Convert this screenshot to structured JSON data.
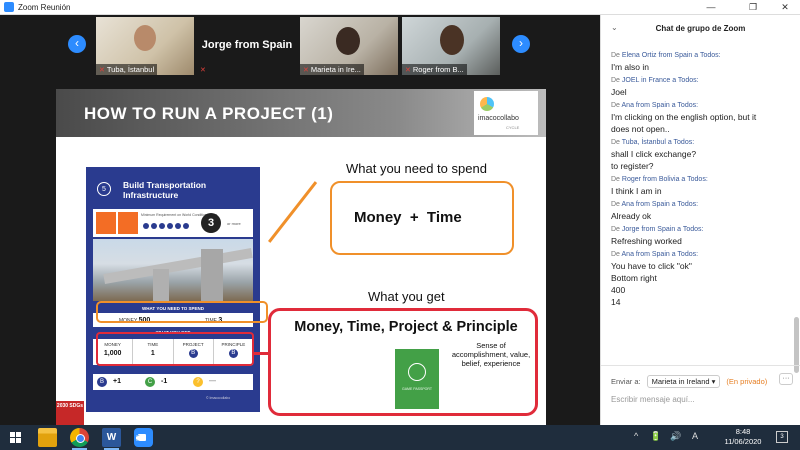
{
  "window": {
    "title": "Zoom Reunión",
    "controls": [
      "—",
      "❐",
      "✕"
    ]
  },
  "gallery": {
    "prev_icon": "chevron-left-icon",
    "next_icon": "chevron-right-icon",
    "participants": [
      {
        "name": "Tuba, İstanbul",
        "muted": true
      },
      {
        "name": "Jorge from Spain",
        "muted": true
      },
      {
        "name": "Marieta in Ire...",
        "muted": true
      },
      {
        "name": "Roger from B...",
        "muted": true
      }
    ]
  },
  "slide": {
    "title": "HOW TO RUN A PROJECT (1)",
    "logo": {
      "name": "imacocollabo",
      "tagline": "CYCLE"
    },
    "card": {
      "number": "5",
      "title_line1": "Build Transportation",
      "title_line2": "Infrastructure",
      "requirement_label": "Minimum Requirement on World Condition Meter",
      "big_number": "3",
      "unit": "or more",
      "spend_header": "WHAT YOU NEED TO SPEND",
      "money_label": "MONEY",
      "money_value": "500",
      "time_label": "TIME",
      "time_value": "3",
      "get_header": "WHAT YOU GET",
      "get_cells": [
        {
          "label": "MONEY",
          "value": "1,000"
        },
        {
          "label": "TIME",
          "value": "1"
        },
        {
          "label": "PROJECT",
          "value": "B"
        },
        {
          "label": "PRINCIPLE",
          "value": "B"
        }
      ],
      "effects": [
        {
          "icon": "B",
          "color": "#2a3b8f",
          "value": "+1"
        },
        {
          "icon": "C",
          "color": "#43a047",
          "value": "-1"
        },
        {
          "icon": "?",
          "color": "#fbc02d",
          "value": "—"
        }
      ],
      "footer": "© Imacocollabo"
    },
    "spend_heading": "What you need to spend",
    "spend_box": "Money  +  Time",
    "get_heading": "What you get",
    "get_box": "Money, Time, Project & Principle",
    "passport_text": "GAME PASSPORT",
    "sense_text": "Sense of accomplishment, value, belief, experience",
    "sdg_badge": "2030 SDGs",
    "colors": {
      "spend_outline": "#f0902a",
      "get_outline": "#e02b3a",
      "card_blue": "#2a3b8f"
    }
  },
  "chat": {
    "title": "Chat de grupo de Zoom",
    "collapse_icon": "chevron-down-icon",
    "messages": [
      {
        "prefix": "De",
        "from": "Elena Ortiz from Spain a Todos:",
        "lines": [
          "I'm also in"
        ]
      },
      {
        "prefix": "De",
        "from": "JOEL in France a Todos:",
        "lines": [
          "Joel"
        ]
      },
      {
        "prefix": "De",
        "from": "Ana from Spain a Todos:",
        "lines": [
          "I'm clicking on the english option, but it",
          "does not open.."
        ]
      },
      {
        "prefix": "De",
        "from": "Tuba, İstanbul a Todos:",
        "lines": [
          "shall I click exchange?",
          "to register?"
        ]
      },
      {
        "prefix": "De",
        "from": "Roger from Bolivia a Todos:",
        "lines": [
          "I think I am in"
        ]
      },
      {
        "prefix": "De",
        "from": "Ana from Spain a Todos:",
        "lines": [
          "Already ok"
        ]
      },
      {
        "prefix": "De",
        "from": "Jorge from Spain a Todos:",
        "lines": [
          "Refreshing worked"
        ]
      },
      {
        "prefix": "De",
        "from": "Ana from Spain a Todos:",
        "lines": [
          "You have to click \"ok\"",
          "Bottom right",
          "400",
          "14"
        ]
      }
    ],
    "send_to_label": "Enviar a:",
    "send_to_value": "Marieta in Ireland",
    "send_to_arrow": "▾",
    "private_label": "(En privado)",
    "more_label": "···",
    "input_placeholder": "Escribir mensaje aquí..."
  },
  "taskbar": {
    "apps": [
      "windows-start",
      "file-explorer",
      "chrome",
      "word",
      "zoom"
    ],
    "word_label": "W",
    "tray_icons": [
      "^",
      "🔋",
      "🔊",
      "A"
    ],
    "time": "8:48",
    "date": "11/06/2020",
    "notifications": "3"
  }
}
